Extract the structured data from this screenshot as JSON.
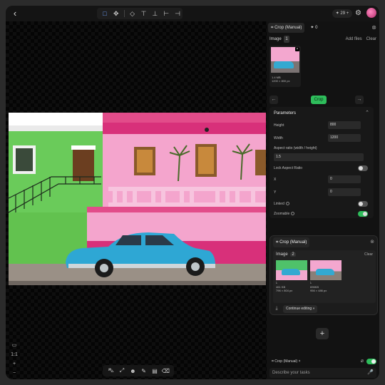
{
  "topbar": {
    "back_icon": "chevron-left-icon",
    "tools": [
      "crop-icon",
      "move-icon",
      "align-center-icon",
      "align-top-icon",
      "align-bottom-icon",
      "align-left-icon",
      "align-right-icon"
    ],
    "credits": "29",
    "gear_icon": "gear-icon"
  },
  "panel": {
    "tab1": "Crop (Manual)",
    "tab2": "0",
    "image_header": "Image",
    "image_count": "1",
    "add_files": "Add files",
    "clear": "Clear",
    "thumb_size": "1.4 MB",
    "thumb_dims": "1200 × 800 px",
    "step_label": "Crop",
    "params_title": "Parameters",
    "height_label": "Height",
    "height_value": "800",
    "width_label": "Width",
    "width_value": "1200",
    "aspect_label": "Aspect ratio (width / height)",
    "aspect_value": "1.5",
    "lock_label": "Lock Aspect Ratio",
    "x_label": "X",
    "x_value": "0",
    "y_label": "Y",
    "y_value": "0",
    "linked_label": "Linked",
    "zoomable_label": "Zoomable"
  },
  "result_card": {
    "title": "Crop (Manual)",
    "image_header": "Image",
    "image_count": "2",
    "clear": "Clear",
    "thumbs": [
      {
        "size": "461 KB",
        "dims": "796 × 804 px"
      },
      {
        "size": "696KB",
        "dims": "956 × 486 px"
      }
    ],
    "continue": "Continue editing"
  },
  "footer": {
    "chip": "Crop (Manual)",
    "placeholder": "Describe your tasks"
  },
  "canvas": {
    "zoom_controls": [
      "1:1",
      "+",
      "−"
    ],
    "bottom_tools": [
      "car-icon",
      "expand-icon",
      "person-icon",
      "brush-icon",
      "layers-icon",
      "eraser-icon"
    ]
  },
  "colors": {
    "accent_green": "#2ebd5b",
    "accent_blue": "#6fa2ff",
    "car_blue": "#34a9d1",
    "wall_pink": "#f3a7cf",
    "wall_green": "#4fc26a"
  }
}
